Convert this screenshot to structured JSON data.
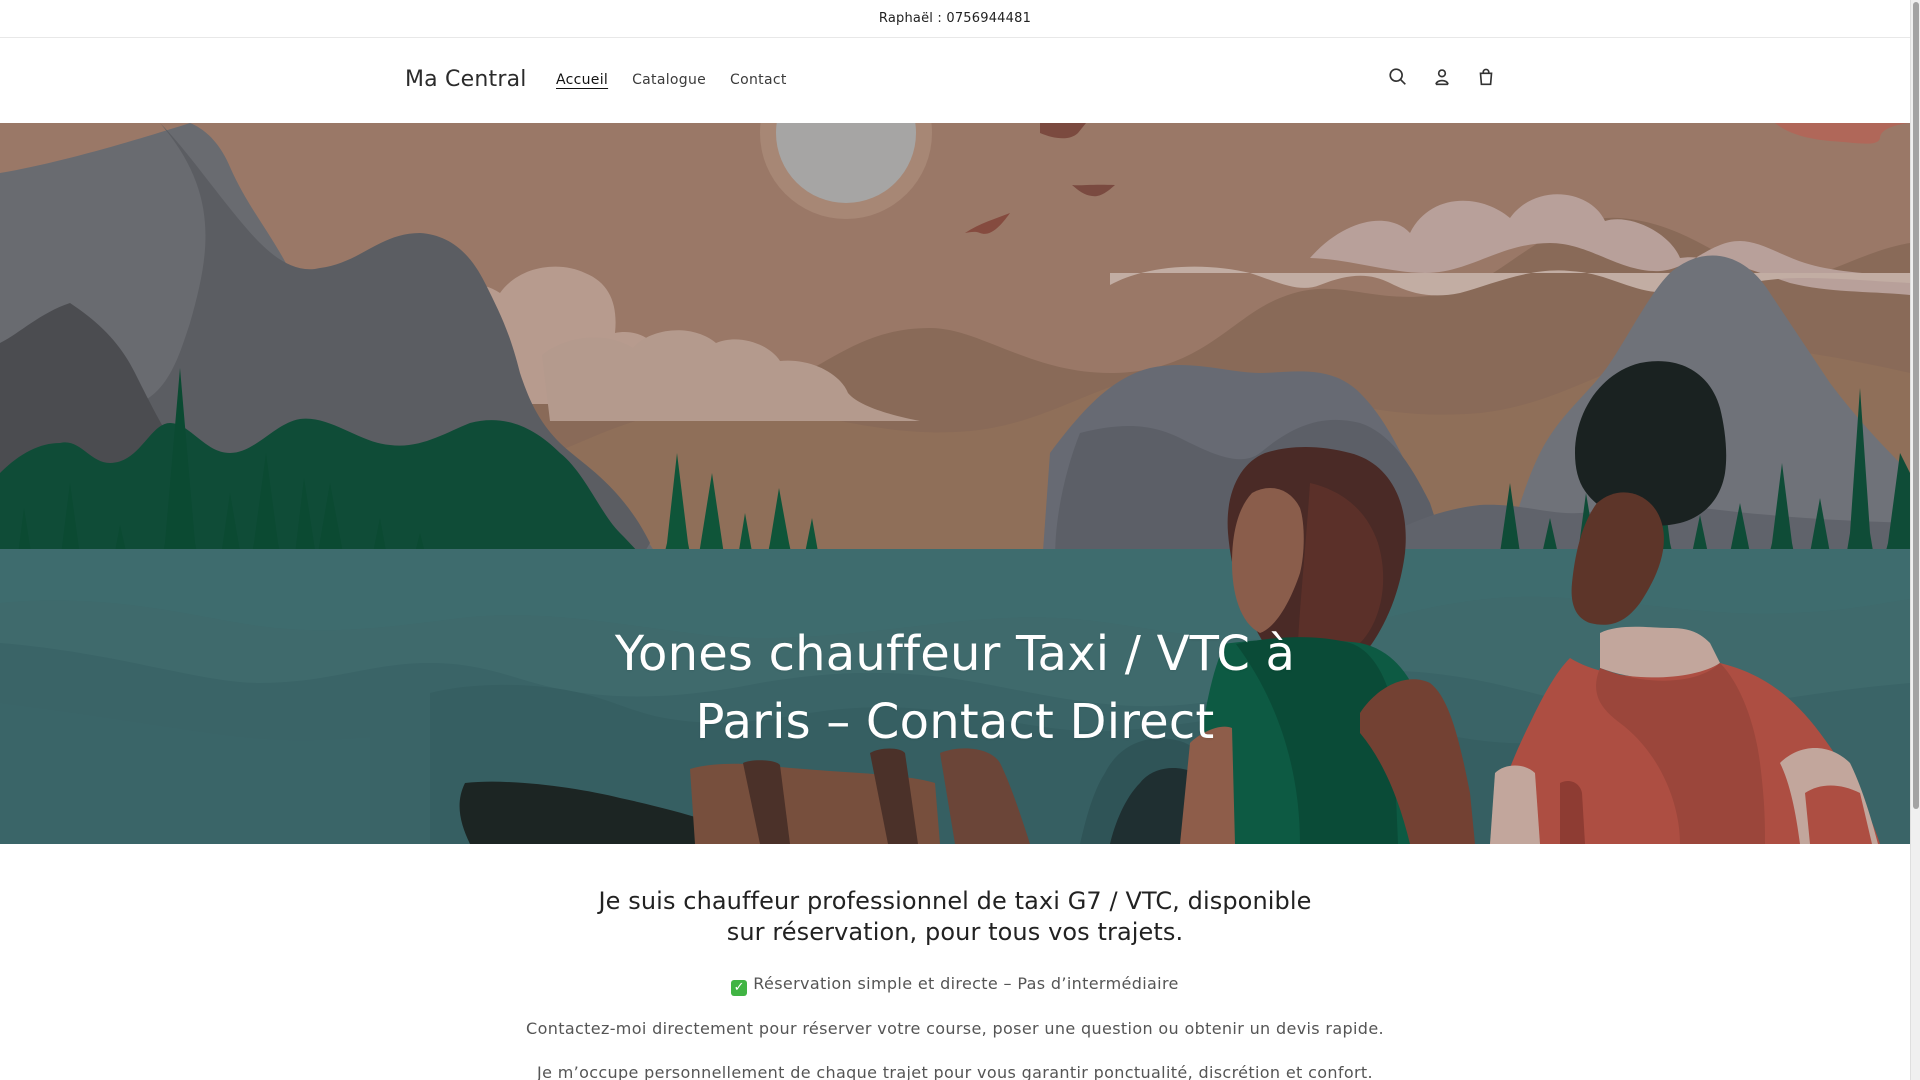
{
  "announcement": {
    "text": "Raphaël : 0756944481"
  },
  "header": {
    "logo": "Ma Central",
    "nav": [
      {
        "label": "Accueil",
        "active": true
      },
      {
        "label": "Catalogue",
        "active": false
      },
      {
        "label": "Contact",
        "active": false
      }
    ],
    "icons": [
      "search-icon",
      "account-icon",
      "cart-icon"
    ]
  },
  "hero": {
    "title": "Yones chauffeur Taxi / VTC à Paris – Contact Direct"
  },
  "content": {
    "lead": "Je suis chauffeur professionnel de taxi G7 / VTC, disponible sur réservation, pour tous vos trajets.",
    "line1": "Réservation simple et directe – Pas d’intermédiaire",
    "line2": "Contactez-moi directement pour réserver votre course, poser une question ou obtenir un devis rapide.",
    "line3": "Je m’occupe personnellement de chaque trajet pour vous garantir ponctualité, discrétion et confort."
  },
  "colors": {
    "hero_sky": "#8f6f59",
    "hero_water": "#3e6c6e",
    "forest": "#0f4c37",
    "mountain": "#6b6d72",
    "cloud": "#b69a8e",
    "checkmark": "#40b443"
  }
}
